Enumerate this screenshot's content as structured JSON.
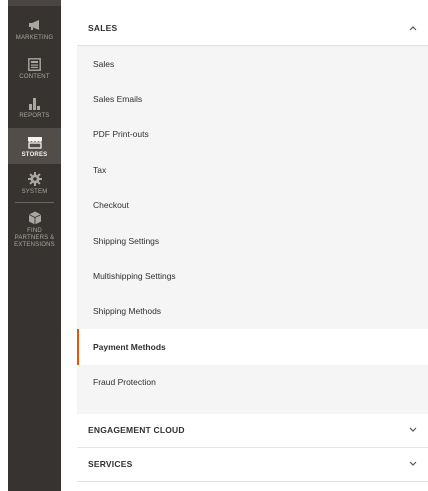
{
  "sidebar": {
    "items": [
      {
        "label": "MARKETING",
        "icon": "megaphone-icon"
      },
      {
        "label": "CONTENT",
        "icon": "content-icon"
      },
      {
        "label": "REPORTS",
        "icon": "bar-chart-icon"
      },
      {
        "label": "STORES",
        "icon": "store-icon",
        "active": true
      },
      {
        "label": "SYSTEM",
        "icon": "gear-icon"
      },
      {
        "label": "FIND PARTNERS & EXTENSIONS",
        "icon": "cube-icon"
      }
    ]
  },
  "sales": {
    "title": "SALES",
    "items": [
      "Sales",
      "Sales Emails",
      "PDF Print-outs",
      "Tax",
      "Checkout",
      "Shipping Settings",
      "Multishipping Settings",
      "Shipping Methods",
      "Payment Methods",
      "Fraud Protection"
    ],
    "active_item": "Payment Methods"
  },
  "sections": {
    "engagement": "ENGAGEMENT CLOUD",
    "services": "SERVICES"
  },
  "colors": {
    "sidebar_bg": "#373330",
    "active_accent": "#eb5202",
    "sub_bg": "#f5f5f5"
  }
}
